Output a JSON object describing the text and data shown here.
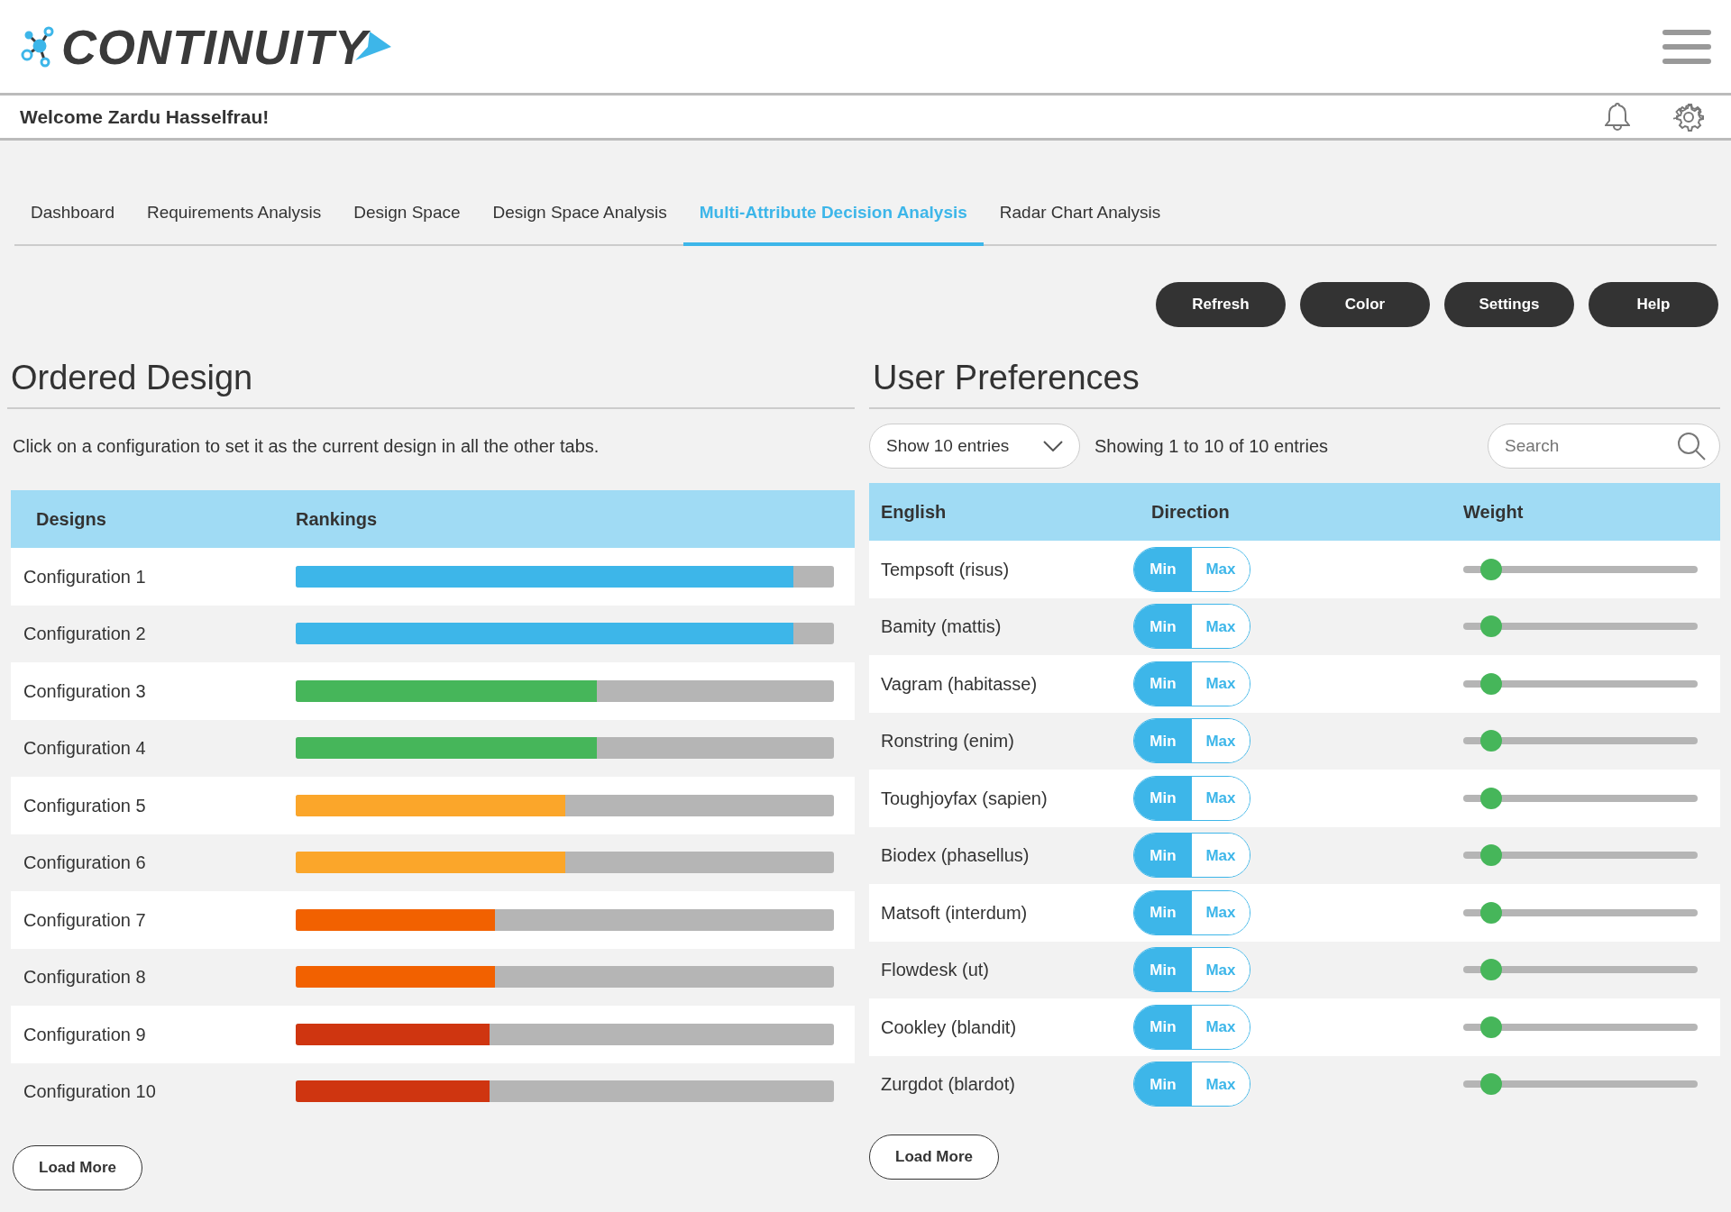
{
  "logo": {
    "text": "CONTINUITY"
  },
  "welcome": "Welcome Zardu Hasselfrau!",
  "tabs": [
    {
      "label": "Dashboard",
      "selected": false
    },
    {
      "label": "Requirements Analysis",
      "selected": false
    },
    {
      "label": "Design Space",
      "selected": false
    },
    {
      "label": "Design Space Analysis",
      "selected": false
    },
    {
      "label": "Multi-Attribute Decision Analysis",
      "selected": true
    },
    {
      "label": "Radar Chart Analysis",
      "selected": false
    }
  ],
  "buttons": [
    "Refresh",
    "Color",
    "Settings",
    "Help"
  ],
  "ordered_design": {
    "title": "Ordered Design",
    "description": "Click on a configuration to set it as the current design in all the other tabs.",
    "columns": [
      "Designs",
      "Rankings"
    ],
    "rows": [
      {
        "name": "Configuration 1",
        "level": 0.925,
        "color": "#3db6e9"
      },
      {
        "name": "Configuration 2",
        "level": 0.925,
        "color": "#3db6e9"
      },
      {
        "name": "Configuration 3",
        "level": 0.56,
        "color": "#46b65a"
      },
      {
        "name": "Configuration 4",
        "level": 0.56,
        "color": "#46b65a"
      },
      {
        "name": "Configuration 5",
        "level": 0.5,
        "color": "#fba62a"
      },
      {
        "name": "Configuration 6",
        "level": 0.5,
        "color": "#fba62a"
      },
      {
        "name": "Configuration 7",
        "level": 0.37,
        "color": "#f26100"
      },
      {
        "name": "Configuration 8",
        "level": 0.37,
        "color": "#f26100"
      },
      {
        "name": "Configuration 9",
        "level": 0.36,
        "color": "#cf3510"
      },
      {
        "name": "Configuration 10",
        "level": 0.36,
        "color": "#cf3510"
      }
    ],
    "load_more": "Load More"
  },
  "user_preferences": {
    "title": "User Preferences",
    "page_size": "Show 10 entries",
    "info": "Showing 1 to 10 of 10 entries",
    "search": {
      "placeholder": "Search"
    },
    "columns": [
      "English",
      "Direction",
      "Weight"
    ],
    "rows": [
      {
        "name": "Tempsoft (risus)",
        "direction": [
          {
            "label": "Min",
            "selected": true
          },
          {
            "label": "Max",
            "selected": false
          }
        ],
        "level": 0.12
      },
      {
        "name": "Bamity (mattis)",
        "direction": [
          {
            "label": "Min",
            "selected": true
          },
          {
            "label": "Max",
            "selected": false
          }
        ],
        "level": 0.12
      },
      {
        "name": "Vagram (habitasse)",
        "direction": [
          {
            "label": "Min",
            "selected": true
          },
          {
            "label": "Max",
            "selected": false
          }
        ],
        "level": 0.12
      },
      {
        "name": "Ronstring (enim)",
        "direction": [
          {
            "label": "Min",
            "selected": true
          },
          {
            "label": "Max",
            "selected": false
          }
        ],
        "level": 0.12
      },
      {
        "name": "Toughjoyfax (sapien)",
        "direction": [
          {
            "label": "Min",
            "selected": true
          },
          {
            "label": "Max",
            "selected": false
          }
        ],
        "level": 0.12
      },
      {
        "name": "Biodex (phasellus)",
        "direction": [
          {
            "label": "Min",
            "selected": true
          },
          {
            "label": "Max",
            "selected": false
          }
        ],
        "level": 0.12
      },
      {
        "name": "Matsoft (interdum)",
        "direction": [
          {
            "label": "Min",
            "selected": true
          },
          {
            "label": "Max",
            "selected": false
          }
        ],
        "level": 0.12
      },
      {
        "name": "Flowdesk (ut)",
        "direction": [
          {
            "label": "Min",
            "selected": true
          },
          {
            "label": "Max",
            "selected": false
          }
        ],
        "level": 0.12
      },
      {
        "name": "Cookley (blandit)",
        "direction": [
          {
            "label": "Min",
            "selected": true
          },
          {
            "label": "Max",
            "selected": false
          }
        ],
        "level": 0.12
      },
      {
        "name": "Zurgdot (blardot)",
        "direction": [
          {
            "label": "Min",
            "selected": true
          },
          {
            "label": "Max",
            "selected": false
          }
        ],
        "level": 0.12
      }
    ],
    "load_more": "Load More"
  }
}
